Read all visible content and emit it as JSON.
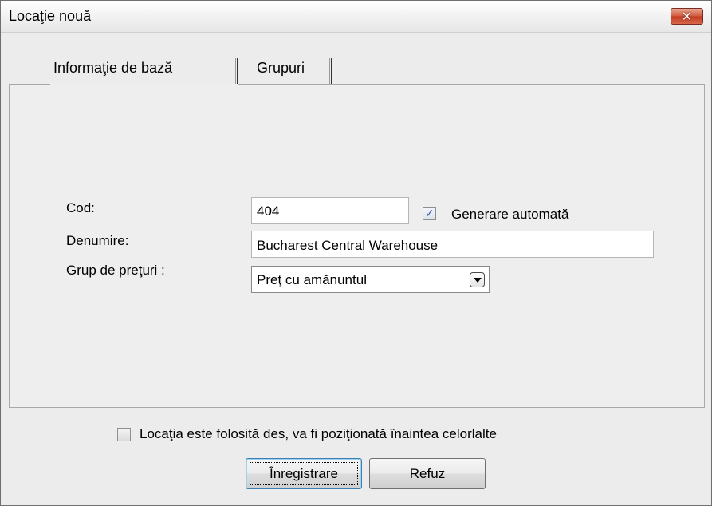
{
  "window": {
    "title": "Locaţie nouă",
    "close_label": "✕"
  },
  "tabs": [
    {
      "label": "Informaţie de bază",
      "active": true
    },
    {
      "label": "Grupuri",
      "active": false
    }
  ],
  "form": {
    "code_label": "Cod:",
    "code_value": "404",
    "auto_generate_label": "Generare automată",
    "auto_generate_checked": true,
    "name_label": "Denumire:",
    "name_value": "Bucharest Central Warehouse",
    "price_group_label": "Grup de preţuri :",
    "price_group_value": "Preţ cu amănuntul"
  },
  "frequent_checkbox": {
    "label": "Locaţia este folosită des, va fi poziţionată înaintea celorlalte",
    "checked": false
  },
  "buttons": {
    "save_label": "Înregistrare",
    "cancel_label": "Refuz"
  },
  "colors": {
    "close_button": "#c23d22",
    "checkmark": "#3d56a1"
  }
}
